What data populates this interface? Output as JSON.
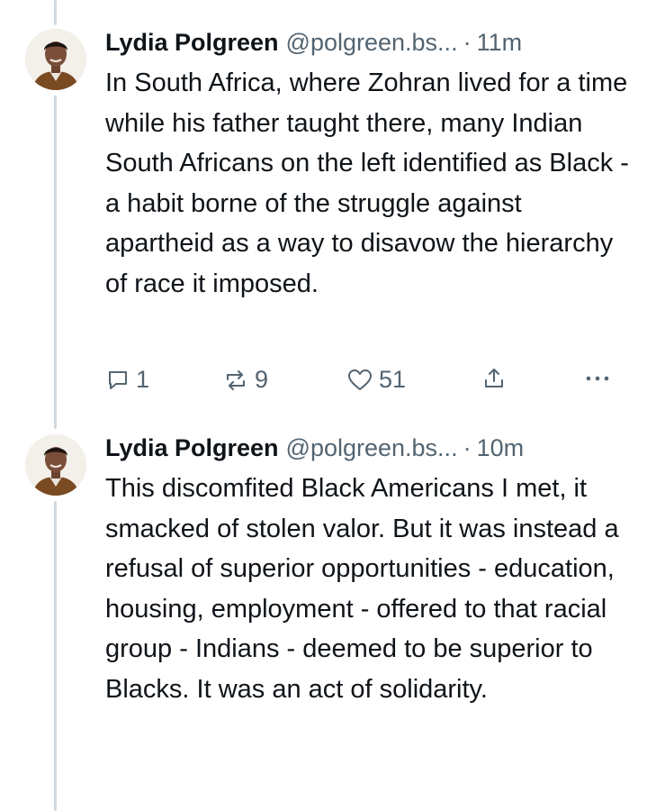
{
  "posts": [
    {
      "author": {
        "name": "Lydia Polgreen",
        "handle": "@polgreen.bs..."
      },
      "time": "11m",
      "separator": "·",
      "text": "In South Africa, where Zohran lived for a time while his father taught there, many Indian South Africans on the left identified as Black - a habit borne of the struggle against apartheid as a way to disavow the hierarchy of race it imposed.",
      "actions": {
        "replies": "1",
        "reposts": "9",
        "likes": "51"
      },
      "icons": [
        "reply-icon",
        "repost-icon",
        "like-icon",
        "share-icon",
        "more-icon"
      ]
    },
    {
      "author": {
        "name": "Lydia Polgreen",
        "handle": "@polgreen.bs..."
      },
      "time": "10m",
      "separator": "·",
      "text": "This discomfited Black Americans I met, it smacked of stolen valor. But it was instead a refusal of superior opportunities - education, housing, employment - offered to that racial group - Indians - deemed to be superior to Blacks. It was an act of solidarity."
    }
  ],
  "colors": {
    "text": "#0f1419",
    "secondary": "#536471",
    "thread_line": "#cfd9de"
  }
}
